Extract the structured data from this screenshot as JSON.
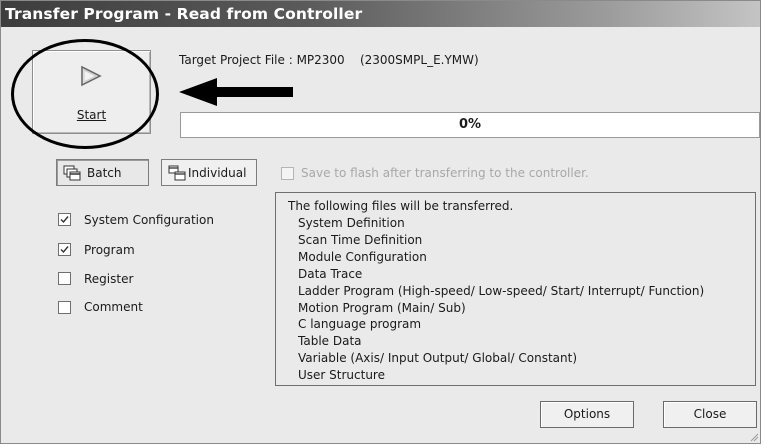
{
  "window": {
    "title": "Transfer Program - Read from Controller"
  },
  "start": {
    "label": "Start",
    "icon": "play-triangle-icon"
  },
  "target": {
    "label": "Target Project File : MP2300    (2300SMPL_E.YMW)"
  },
  "progress": {
    "percent": 0,
    "text": "0%"
  },
  "mode": {
    "batch_label": "Batch",
    "individual_label": "Individual",
    "batch_icon": "batch-windows-icon",
    "individual_icon": "individual-windows-icon"
  },
  "save_flash": {
    "label": "Save to flash after transferring to the controller.",
    "checked": false,
    "enabled": false
  },
  "items": [
    {
      "label": "System Configuration",
      "checked": true
    },
    {
      "label": "Program",
      "checked": true
    },
    {
      "label": "Register",
      "checked": false
    },
    {
      "label": "Comment",
      "checked": false
    }
  ],
  "files": {
    "header": "The following files will be transferred.",
    "list": [
      "System Definition",
      "Scan Time Definition",
      "Module Configuration",
      "Data Trace",
      "Ladder Program (High-speed/ Low-speed/ Start/ Interrupt/ Function)",
      "Motion Program (Main/ Sub)",
      "C language program",
      "Table Data",
      "Variable (Axis/ Input Output/ Global/ Constant)",
      "User Structure"
    ]
  },
  "buttons": {
    "options": "Options",
    "close": "Close"
  }
}
